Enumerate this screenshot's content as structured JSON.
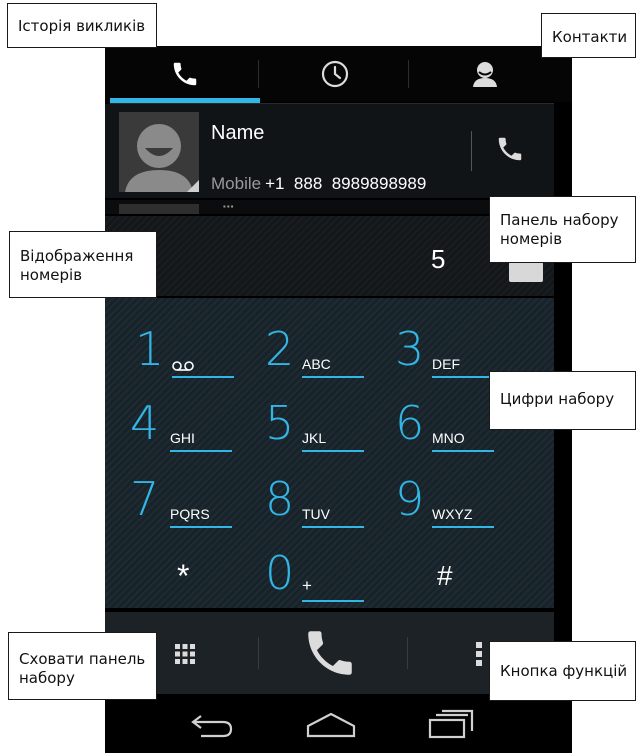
{
  "tabs": [
    {
      "icon": "phone-icon",
      "selected": true
    },
    {
      "icon": "clock-icon",
      "selected": false
    },
    {
      "icon": "person-icon",
      "selected": false
    }
  ],
  "accent_color": "#33b5e5",
  "contact": {
    "name": "Name",
    "phone_label": "Mobile",
    "phone_number": "+1  888  8989898989"
  },
  "dialed_digits": "5",
  "keypad": [
    {
      "digit": "1",
      "letters": "",
      "icon": "voicemail-icon"
    },
    {
      "digit": "2",
      "letters": "ABC"
    },
    {
      "digit": "3",
      "letters": "DEF"
    },
    {
      "digit": "4",
      "letters": "GHI"
    },
    {
      "digit": "5",
      "letters": "JKL"
    },
    {
      "digit": "6",
      "letters": "MNO"
    },
    {
      "digit": "7",
      "letters": "PQRS"
    },
    {
      "digit": "8",
      "letters": "TUV"
    },
    {
      "digit": "9",
      "letters": "WXYZ"
    },
    {
      "digit": "*",
      "letters": ""
    },
    {
      "digit": "0",
      "letters": "+"
    },
    {
      "digit": "#",
      "letters": ""
    }
  ],
  "actions": [
    "dialpad-grid-icon",
    "call-icon",
    "overflow-menu-icon"
  ],
  "navbar": [
    "back-icon",
    "home-icon",
    "recents-icon"
  ],
  "callouts": {
    "call_history": "Історія викликів",
    "contacts": "Контакти",
    "number_display": "Відображення номерів",
    "dial_panel": "Панель набору номерів",
    "dial_digits": "Цифри набору",
    "hide_dialpad": "Сховати панель набору",
    "menu_button": "Кнопка функцій"
  }
}
